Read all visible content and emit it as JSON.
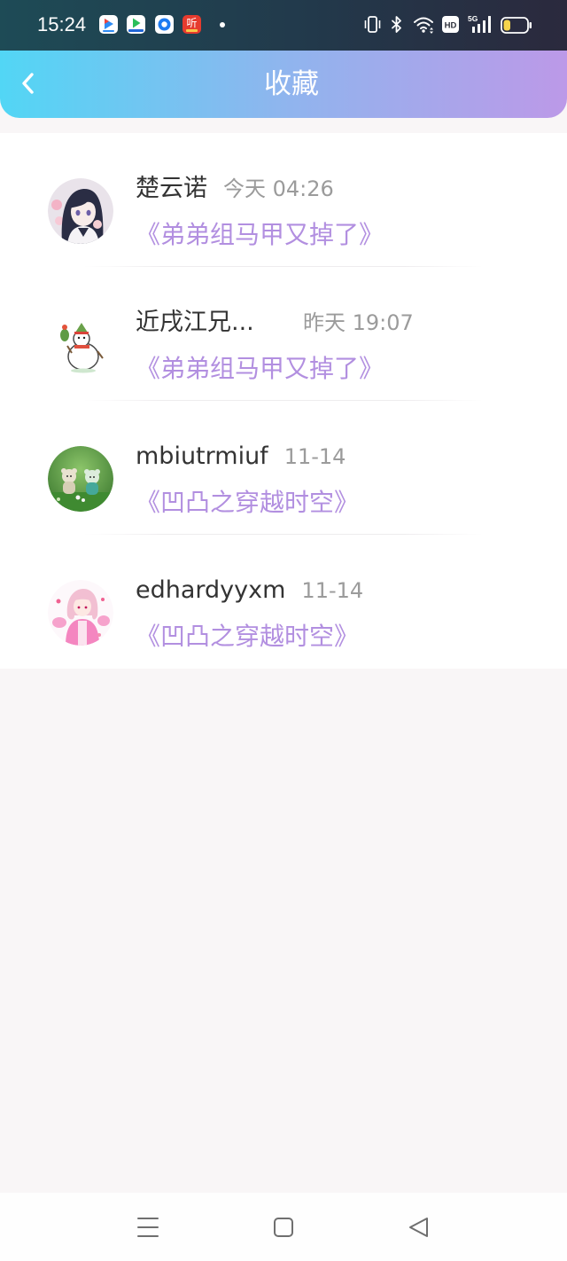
{
  "status_bar": {
    "time": "15:24",
    "notification_icons": [
      "video-app-notification-icon",
      "player-app-notification-icon",
      "browser-app-notification-icon",
      "listen-app-notification-icon",
      "more-notifications-dot-icon"
    ],
    "listen_app_logo_text": "听",
    "indicator_icons": [
      "vibrate-icon",
      "bluetooth-icon",
      "wifi-icon",
      "hd-icon",
      "signal-5g-icon",
      "battery-icon"
    ],
    "hd_label": "HD",
    "network_label": "5G",
    "battery_level": 0.3
  },
  "header": {
    "title": "收藏",
    "back_icon": "chevron-left-icon"
  },
  "favorites": [
    {
      "name": "楚云诺",
      "time": "今天 04:26",
      "book": "《弟弟组马甲又掉了》"
    },
    {
      "name": "近戌江兄...",
      "time": "昨天 19:07",
      "book": "《弟弟组马甲又掉了》"
    },
    {
      "name": "mbiutrmiuf",
      "time": "11-14",
      "book": "《凹凸之穿越时空》"
    },
    {
      "name": "edhardyyxm",
      "time": "11-14",
      "book": "《凹凸之穿越时空》"
    }
  ],
  "nav_bar": {
    "icons": [
      "menu-icon",
      "home-square-icon",
      "back-triangle-icon"
    ]
  },
  "colors": {
    "status_bar_start": "#1e4b56",
    "status_bar_mid": "#22394b",
    "status_bar_end": "#2b293d",
    "header_start": "#52d6f5",
    "header_mid": "#8fb5ee",
    "header_end": "#bc99e8",
    "name_text": "#333333",
    "time_text": "#9b9b9b",
    "book_title": "#b28fe0",
    "page_background": "#f9f6f7",
    "battery_fill": "#f6d54c"
  }
}
